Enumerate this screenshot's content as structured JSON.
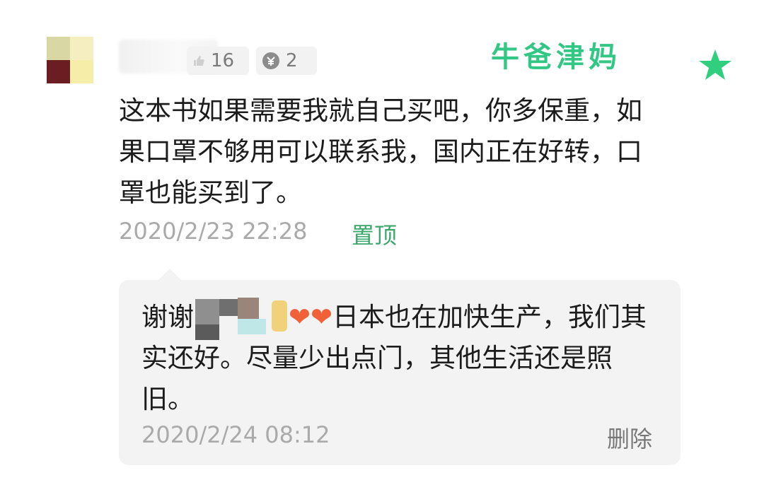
{
  "post": {
    "like_count": "16",
    "coin_count": "2",
    "watermark": "牛爸津妈",
    "comment": "这本书如果需要我就自己买吧，你多保重，如果口罩不够用可以联系我，国内正在好转，口罩也能买到了。",
    "timestamp": "2020/2/23 22:28",
    "pin_label": "置顶"
  },
  "reply": {
    "prefix": "谢谢",
    "emoji": "❤❤",
    "text": "日本也在加快生产，我们其实还好。尽量少出点门，其他生活还是照旧。",
    "timestamp": "2020/2/24 08:12",
    "delete_label": "删除"
  },
  "colors": {
    "accent_green": "#33c785",
    "link_green": "#3aa86a",
    "heart": "#f0613a"
  },
  "icons": [
    "thumb-up-icon",
    "coin-icon",
    "star-icon",
    "heart-icon"
  ]
}
